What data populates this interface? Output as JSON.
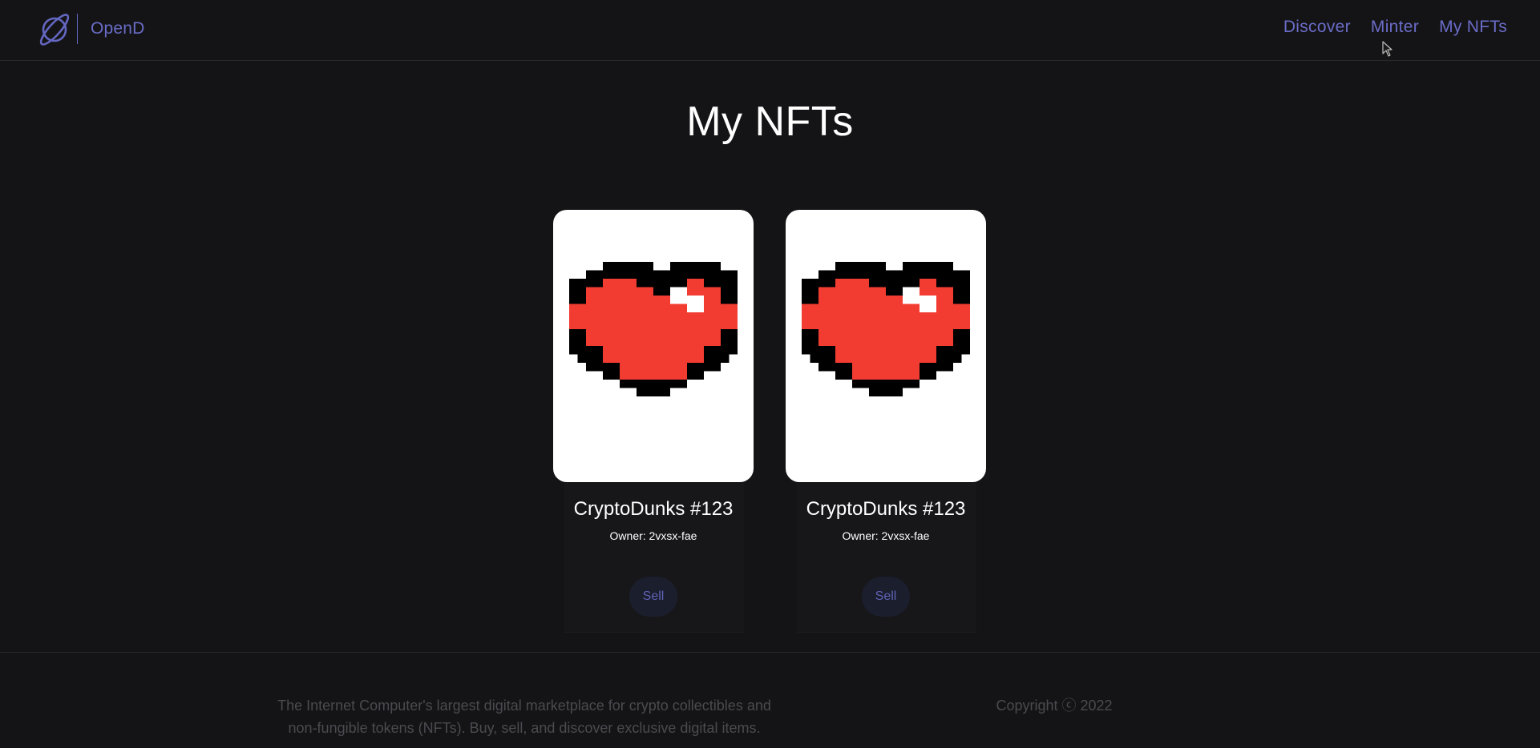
{
  "navbar": {
    "brand_name": "OpenD",
    "links": [
      {
        "label": "Discover"
      },
      {
        "label": "Minter"
      },
      {
        "label": "My NFTs"
      }
    ]
  },
  "main": {
    "title": "My NFTs",
    "nfts": [
      {
        "name": "CryptoDunks #123",
        "owner": "Owner: 2vxsx-fae",
        "action_label": "Sell"
      },
      {
        "name": "CryptoDunks #123",
        "owner": "Owner: 2vxsx-fae",
        "action_label": "Sell"
      }
    ]
  },
  "footer": {
    "blurb": "The Internet Computer's largest digital marketplace for crypto collectibles and non-fungible tokens (NFTs). Buy, sell, and discover exclusive digital items.",
    "copyright": "Copyright ⓒ 2022"
  },
  "colors": {
    "background": "#141416",
    "accent": "#6a6cc8",
    "heart_red": "#f23c32",
    "card_background": "#ffffff"
  },
  "icons": {
    "logo": "planet-icon",
    "nft_image": "pixel-heart-image"
  }
}
